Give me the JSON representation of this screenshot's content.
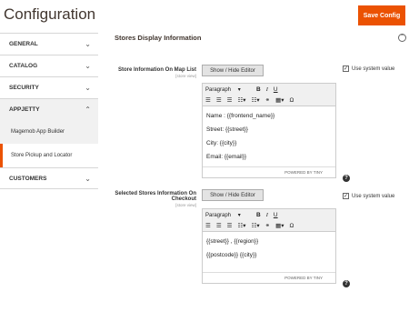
{
  "page": {
    "title": "Configuration"
  },
  "header": {
    "save_label": "Save Config"
  },
  "sidebar": {
    "items": [
      {
        "label": "GENERAL"
      },
      {
        "label": "CATALOG"
      },
      {
        "label": "SECURITY"
      },
      {
        "label": "APPJETTY"
      },
      {
        "label": "CUSTOMERS"
      }
    ],
    "sub_items": [
      {
        "label": "Magemob App Builder"
      },
      {
        "label": "Store Pickup and Locator"
      }
    ]
  },
  "section": {
    "title": "Stores Display Information"
  },
  "fields": [
    {
      "label": "Store Information On Map List",
      "scope": "[store view]",
      "toggle_label": "Show / Hide Editor",
      "format": "Paragraph",
      "lines": [
        "Name : {{frontend_name}}",
        "Street: {{street}}",
        "City: {{city}}",
        "Email: {{email}}"
      ],
      "status": "POWERED BY TINY",
      "use_system": "Use system value"
    },
    {
      "label": "Selected Stores Information On Checkout",
      "scope": "[store view]",
      "toggle_label": "Show / Hide Editor",
      "format": "Paragraph",
      "lines": [
        "{{street}} , {{region}}",
        "{{postcode}} {{city}}"
      ],
      "status": "POWERED BY TINY",
      "use_system": "Use system value"
    }
  ]
}
